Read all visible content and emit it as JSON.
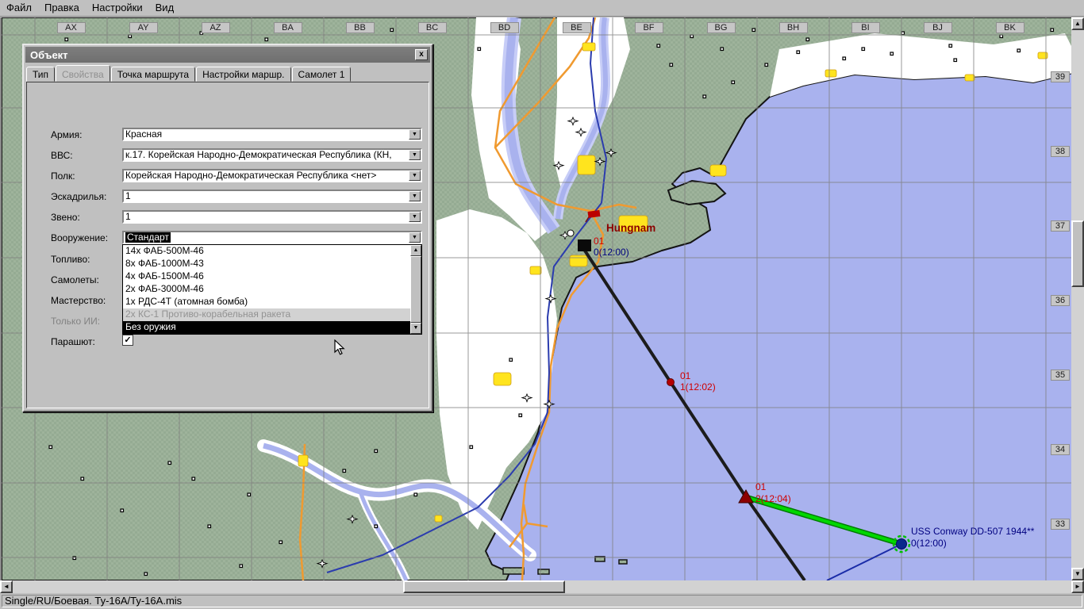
{
  "menu": {
    "items": [
      "Файл",
      "Правка",
      "Настройки",
      "Вид"
    ]
  },
  "map": {
    "columns": [
      "AX",
      "AY",
      "AZ",
      "BA",
      "BB",
      "BC",
      "BD",
      "BE",
      "BF",
      "BG",
      "BH",
      "BI",
      "BJ",
      "BK"
    ],
    "rows": [
      "39",
      "38",
      "37",
      "36",
      "35",
      "34",
      "33"
    ],
    "city_label": "Hungnam",
    "unit": {
      "id_label": "01",
      "time_label": "0(12:00)"
    },
    "waypoint1": {
      "id_label": "01",
      "time_label": "1(12:02)"
    },
    "waypoint2": {
      "id_label": "01",
      "time_label": "2(12:04)"
    },
    "ship": {
      "name_label": "USS Conway DD-507 1944**",
      "time_label": "0(12:00)"
    }
  },
  "dialog": {
    "title": "Объект",
    "close_label": "x",
    "tabs": [
      {
        "label": "Тип",
        "active": false
      },
      {
        "label": "Свойства",
        "active": true
      },
      {
        "label": "Точка маршрута",
        "active": false
      },
      {
        "label": "Настройки маршр.",
        "active": false
      },
      {
        "label": "Самолет 1",
        "active": false
      }
    ],
    "fields": {
      "army": {
        "label": "Армия:",
        "value": "Красная"
      },
      "airforce": {
        "label": "ВВС:",
        "value": "к.17. Корейская Народно-Демократическая Республика (КН,"
      },
      "regiment": {
        "label": "Полк:",
        "value": "Корейская Народно-Демократическая Республика <нет>"
      },
      "squadron": {
        "label": "Эскадрилья:",
        "value": "1"
      },
      "flight": {
        "label": "Звено:",
        "value": "1"
      },
      "armament": {
        "label": "Вооружение:",
        "value": "Стандарт"
      },
      "fuel_label": "Топливо:",
      "aircraft_label": "Самолеты:",
      "skill_label": "Мастерство:",
      "ai_only_label": "Только ИИ:",
      "parachute_label": "Парашют:",
      "parachute_checked": true
    },
    "weapon_list": {
      "items": [
        {
          "label": "14х ФАБ-500М-46",
          "state": "normal"
        },
        {
          "label": "8х ФАБ-1000М-43",
          "state": "normal"
        },
        {
          "label": "4х ФАБ-1500М-46",
          "state": "normal"
        },
        {
          "label": "2х ФАБ-3000М-46",
          "state": "normal"
        },
        {
          "label": "1х РДС-4Т (атомная бомба)",
          "state": "normal"
        },
        {
          "label": "2х КС-1 Противо-корабельная ракета",
          "state": "disabled"
        },
        {
          "label": "Без оружия",
          "state": "selected"
        }
      ]
    }
  },
  "status_bar": {
    "text": "Single/RU/Боевая. Ту-16А/Ту-16А.mis"
  },
  "colors": {
    "sea": "#a9b2ee",
    "land": "#9eb39b",
    "river_light": "#c7cdf7",
    "road_orange": "#f09a30",
    "road_navy": "#2b3cae",
    "city_yellow": "#ffe41e",
    "route_black": "#1c1c1c",
    "route_green": "#00d800",
    "waypoint_red": "#cf0000",
    "label_navy": "#000080",
    "hungnam_red": "#8b0000",
    "dialog_gray": "#c0c0c0"
  }
}
